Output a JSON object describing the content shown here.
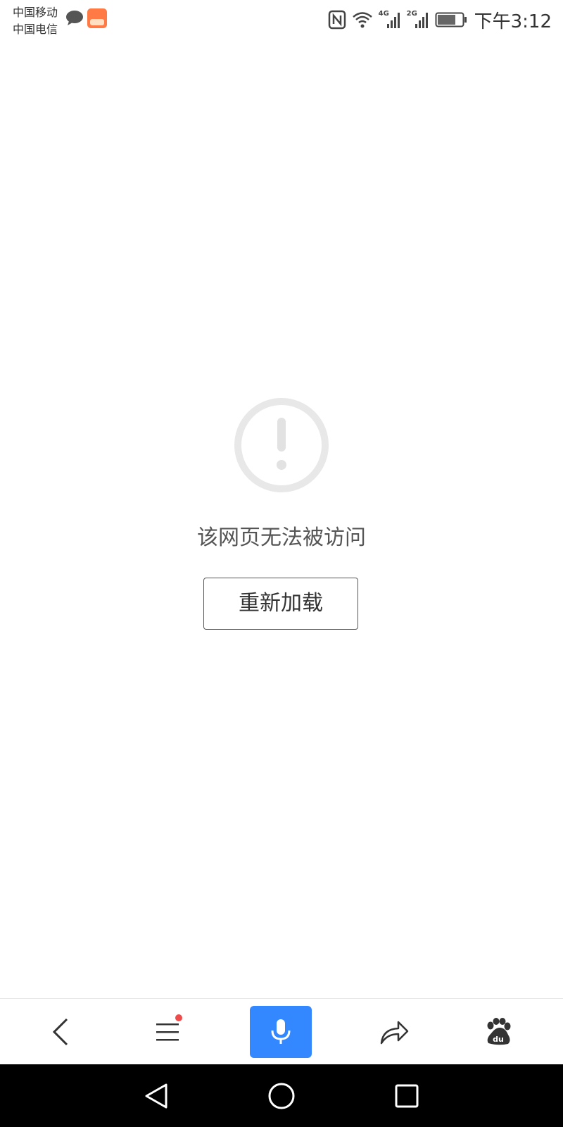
{
  "status_bar": {
    "carrier_1": "中国移动",
    "carrier_2": "中国电信",
    "time": "下午3:12",
    "network_1": "4G",
    "network_2": "2G",
    "icons": [
      "chat-icon",
      "app-notification-icon",
      "nfc-icon",
      "wifi-icon",
      "signal-4g-icon",
      "signal-2g-icon",
      "battery-icon"
    ]
  },
  "error": {
    "icon": "exclamation-circle-icon",
    "message": "该网页无法被访问",
    "reload_label": "重新加载"
  },
  "toolbar": {
    "items": [
      "back-icon",
      "menu-icon",
      "microphone-icon",
      "share-icon",
      "baidu-paw-icon"
    ],
    "accent_color": "#3388ff",
    "notification_dot_color": "#f04b4b"
  },
  "nav_bar": {
    "items": [
      "nav-back-icon",
      "nav-home-icon",
      "nav-recent-icon"
    ]
  }
}
